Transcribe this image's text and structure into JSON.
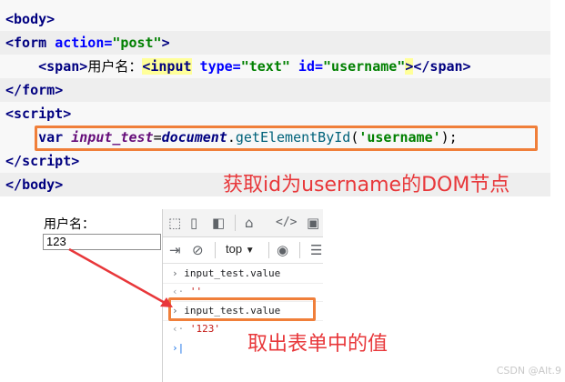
{
  "code": {
    "lines": [
      {
        "open": "<",
        "tag": "body",
        "close": ">"
      },
      {
        "open": "<",
        "tag": "form",
        "attr": "action",
        "eq": "=",
        "val": "\"post\"",
        "close": ">"
      },
      {
        "indent": "    ",
        "open": "<",
        "tag": "span",
        "close": ">",
        "text": "用户名：",
        "open2": "<",
        "tag2": "input",
        "attr1": "type",
        "eq1": "=",
        "val1": "\"text\"",
        "attr2": "id",
        "eq2": "=",
        "val2": "\"username\"",
        "close2": ">",
        "end": "</",
        "endtag": "span",
        "endclose": ">"
      },
      {
        "end": "</",
        "endtag": "form",
        "endclose": ">"
      },
      {
        "open": "<",
        "tag": "script",
        "close": ">"
      },
      {
        "indent": "    ",
        "kw": "var",
        "var": "input_test",
        "eq": "=",
        "obj": "document",
        "dot": ".",
        "fn": "getElementById",
        "lp": "(",
        "arg": "'username'",
        "rp": ");"
      },
      {
        "end": "</",
        "endtag": "script",
        "endclose": ">"
      },
      {
        "end": "</",
        "endtag": "body",
        "endclose": ">"
      }
    ],
    "annotation": "获取id为username的DOM节点"
  },
  "preview": {
    "label": "用户名：",
    "input_value": "123"
  },
  "devtools": {
    "context": "top",
    "console": [
      {
        "prompt": "›",
        "text": "input_test.value"
      },
      {
        "prompt": "‹·",
        "text": "''",
        "type": "string"
      },
      {
        "prompt": "›",
        "text": "input_test.value"
      },
      {
        "prompt": "‹·",
        "text": "'123'",
        "type": "string"
      },
      {
        "prompt": "›",
        "text": "|"
      }
    ]
  },
  "annotation2": "取出表单中的值",
  "watermark": "CSDN @Alt.9",
  "colors": {
    "annotation": "#e8373a",
    "box": "#f07f3a",
    "tag": "#000080",
    "attr": "#0000ff",
    "string": "#008000"
  },
  "icons": [
    "inspect-icon",
    "device-icon",
    "panel-icon",
    "home-icon",
    "sources-icon",
    "console-icon",
    "sidebar-toggle-icon",
    "clear-icon",
    "dropdown-icon",
    "eye-icon",
    "filter-icon"
  ]
}
